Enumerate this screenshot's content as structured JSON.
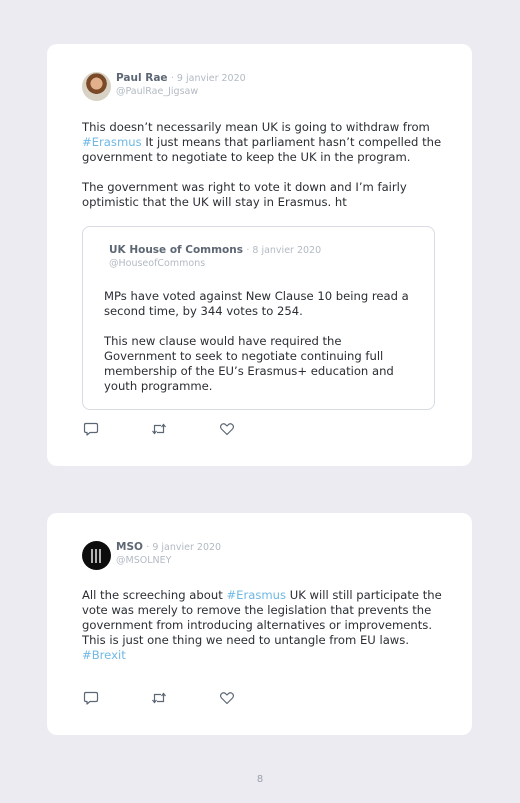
{
  "colors": {
    "background": "#ebebf1",
    "card": "#ffffff",
    "name": "#5d6774",
    "muted": "#b3bac3",
    "hashtag": "#6fb8e3",
    "text": "#2a2e33"
  },
  "tweets": [
    {
      "name": "Paul Rae",
      "date": "· 9 janvier 2020",
      "handle": "@PaulRae_Jigsaw",
      "avatar_icon": "profile-photo",
      "paragraph1": {
        "before": "This doesn’t necessarily mean UK is going to withdraw from ",
        "hashtag": "#Erasmus",
        "after": " It just means that parliament hasn’t compelled the government to negotiate to keep the UK in the program."
      },
      "paragraph2": "The government was right to vote it down and I’m fairly optimistic that the UK will stay in Erasmus. ht",
      "quote": {
        "name": "UK House of Commons",
        "date": "· 8 janvier 2020",
        "handle": "@HouseofCommons",
        "paragraph1": "MPs have voted against New Clause 10 being read a second time, by 344 votes to 254.",
        "paragraph2": "This new clause would have required the Government to seek to negotiate continuing full membership of the EU’s Erasmus+ education and youth programme."
      }
    },
    {
      "name": "MSO",
      "date": "· 9 janvier 2020",
      "handle": "@MSOLNEY",
      "avatar_icon": "dark-logo",
      "text": {
        "before": "All the screeching about ",
        "hashtag1": "#Erasmus",
        "middle": " UK will still participate the vote was merely to remove the legislation that prevents the government from introducing alternatives or improvements. This is just one thing we need to untangle from EU laws. ",
        "hashtag2": "#Brexit"
      }
    }
  ],
  "actions": [
    "reply-icon",
    "retweet-icon",
    "like-icon"
  ],
  "page_number": "8"
}
